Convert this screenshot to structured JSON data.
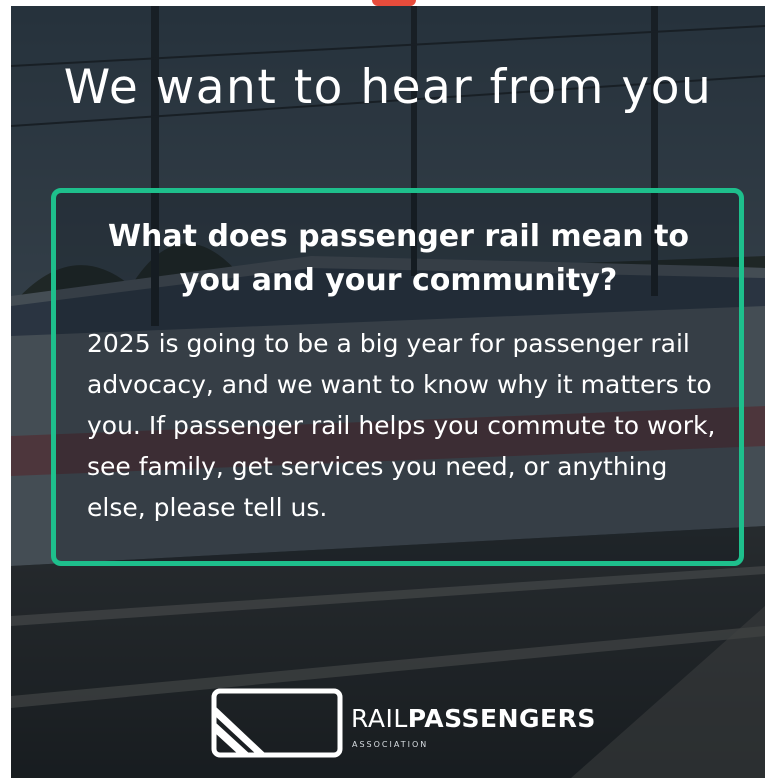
{
  "headline": "We want to hear from you",
  "panel": {
    "question": "What does passenger rail mean to you and your community?",
    "body": "2025 is going to be a big year for passenger rail advocacy, and we want to know why it matters to you. If passenger rail helps you commute to work, see family, get services you need, or anything else, please tell us."
  },
  "logo": {
    "word_light": "RAIL",
    "word_bold": "PASSENGERS",
    "subtitle": "ASSOCIATION"
  },
  "colors": {
    "accent_border": "#1ebf8c",
    "top_fragment": "#e74c3c",
    "overlay": "#0a121a"
  }
}
